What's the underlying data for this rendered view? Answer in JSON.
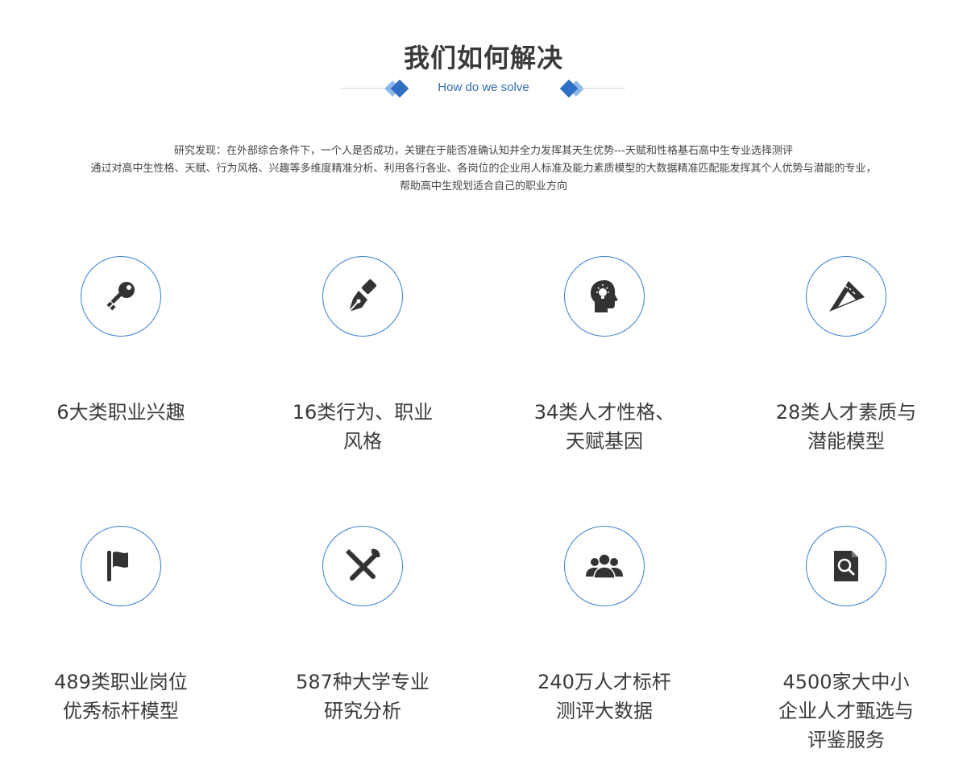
{
  "section": {
    "title": "我们如何解决",
    "subtitle": "How do we solve"
  },
  "intro": {
    "line1": "研究发现：在外部综合条件下，一个人是否成功，关键在于能否准确认知并全力发挥其天生优势---天赋和性格基石高中生专业选择测评",
    "line2": "通过对高中生性格、天赋、行为风格、兴趣等多维度精准分析、利用各行各业、各岗位的企业用人标准及能力素质模型的大数据精准匹配能发挥其个人优势与潜能的专业，",
    "line3": "帮助高中生规划适合自己的职业方向"
  },
  "features": [
    {
      "icon": "key-icon",
      "lines": [
        "6大类职业兴趣"
      ]
    },
    {
      "icon": "pen-nib-icon",
      "lines": [
        "16类行为、职业",
        "风格"
      ]
    },
    {
      "icon": "head-lightbulb-icon",
      "lines": [
        "34类人才性格、",
        "天赋基因"
      ]
    },
    {
      "icon": "set-square-icon",
      "lines": [
        "28类人才素质与",
        "潜能模型"
      ]
    },
    {
      "icon": "flag-icon",
      "lines": [
        "489类职业岗位",
        "优秀标杆模型"
      ]
    },
    {
      "icon": "tools-icon",
      "lines": [
        "587种大学专业",
        "研究分析"
      ]
    },
    {
      "icon": "users-icon",
      "lines": [
        "240万人才标杆",
        "测评大数据"
      ]
    },
    {
      "icon": "document-search-icon",
      "lines": [
        "4500家大中小",
        "企业人才甄选与",
        "评鉴服务"
      ]
    }
  ],
  "colors": {
    "accent": "#3a7fd0",
    "icon": "#333333",
    "diamond_dark": "#2f6fc4",
    "diamond_light": "#8fb8ea"
  }
}
